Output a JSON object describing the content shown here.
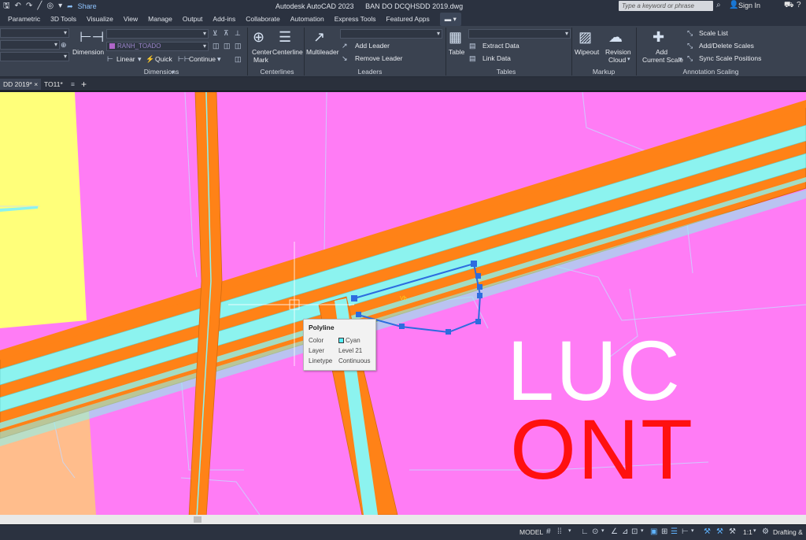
{
  "app": {
    "title": "Autodesk AutoCAD 2023",
    "file": "BAN DO DCQHSDD 2019.dwg",
    "share_label": "Share",
    "search_placeholder": "Type a keyword or phrase",
    "signin_label": "Sign In"
  },
  "ribbon_tabs": [
    "Parametric",
    "3D Tools",
    "Visualize",
    "View",
    "Manage",
    "Output",
    "Add-ins",
    "Collaborate",
    "Automation",
    "Express Tools",
    "Featured Apps"
  ],
  "ribbon": {
    "dimension": {
      "label": "Dimension",
      "layer_combo": "RANH_TOADO",
      "linear_label": "Linear",
      "quick_label": "Quick",
      "continue_label": "Continue",
      "panel_title": "Dimensions"
    },
    "centerlines": {
      "center_mark_line1": "Center",
      "center_mark_line2": "Mark",
      "centerline_label": "Centerline",
      "panel_title": "Centerlines"
    },
    "leaders": {
      "multileader_label": "Multileader",
      "add_leader_label": "Add Leader",
      "remove_leader_label": "Remove Leader",
      "panel_title": "Leaders"
    },
    "tables": {
      "table_label": "Table",
      "extract_data_label": "Extract Data",
      "link_data_label": "Link Data",
      "panel_title": "Tables"
    },
    "markup": {
      "wipeout_label": "Wipeout",
      "revision_line1": "Revision",
      "revision_line2": "Cloud",
      "panel_title": "Markup"
    },
    "annotation_scaling": {
      "add_scale_line1": "Add",
      "add_scale_line2": "Current Scale",
      "scale_list_label": "Scale List",
      "add_delete_label": "Add/Delete Scales",
      "sync_label": "Sync Scale Positions",
      "panel_title": "Annotation Scaling"
    }
  },
  "doc_tabs": [
    {
      "label": "DD 2019*"
    },
    {
      "label": "TO11*"
    }
  ],
  "drawing": {
    "text_luc": "LUC",
    "text_ont": "ONT",
    "small_label": "Vb"
  },
  "tooltip": {
    "title": "Polyline",
    "color_key": "Color",
    "color_value": "Cyan",
    "layer_key": "Layer",
    "layer_value": "Level 21",
    "linetype_key": "Linetype",
    "linetype_value": "Continuous"
  },
  "statusbar": {
    "model_label": "MODEL",
    "scale_label": "1:1",
    "workspace_label": "Drafting &"
  },
  "colors": {
    "land_pink": "#ff7cf5",
    "road_orange": "#ff8217",
    "road_cyan": "#8cf3ef",
    "land_yellow": "#ffff7a",
    "land_peach": "#ffbd8c",
    "selection_blue": "#2d6cdf",
    "ont_red": "#ff1010"
  }
}
